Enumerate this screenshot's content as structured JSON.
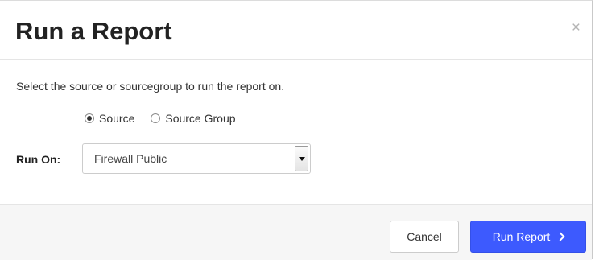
{
  "dialog": {
    "title": "Run a Report",
    "close_symbol": "×",
    "description": "Select the source or sourcegroup to run the report on."
  },
  "source_type": {
    "options": [
      {
        "label": "Source",
        "checked": true
      },
      {
        "label": "Source Group",
        "checked": false
      }
    ]
  },
  "run_on": {
    "label": "Run On:",
    "selected": "Firewall Public"
  },
  "footer": {
    "cancel_label": "Cancel",
    "run_label": "Run Report"
  },
  "colors": {
    "primary": "#3d5afe",
    "footer_bg": "#f6f6f6"
  },
  "icons": {
    "close": "close-icon",
    "dropdown": "chevron-down-icon",
    "run": "chevron-right-icon"
  }
}
